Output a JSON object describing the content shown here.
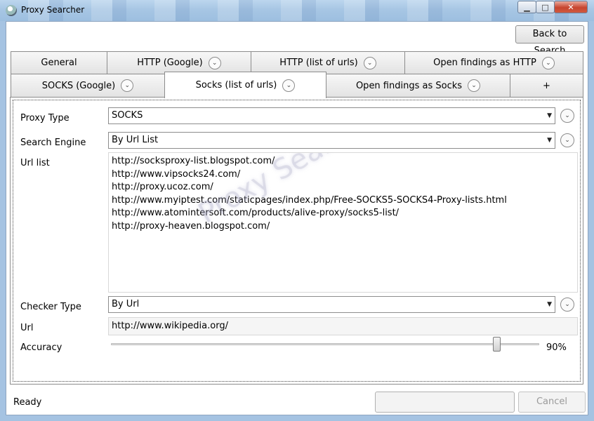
{
  "window": {
    "title": "Proxy Searcher",
    "minimize_glyph": "▁",
    "maximize_glyph": "□",
    "close_glyph": "✕"
  },
  "toolbar": {
    "back_label": "Back to Search"
  },
  "tabs": {
    "row1": [
      {
        "label": "General"
      },
      {
        "label": "HTTP (Google)"
      },
      {
        "label": "HTTP (list of urls)"
      },
      {
        "label": "Open findings as HTTP"
      }
    ],
    "row2": [
      {
        "label": "SOCKS (Google)"
      },
      {
        "label": "Socks (list of urls)"
      },
      {
        "label": "Open findings as Socks"
      },
      {
        "label": "+"
      }
    ],
    "active": "Socks (list of urls)"
  },
  "form": {
    "proxy_type": {
      "label": "Proxy Type",
      "value": "SOCKS"
    },
    "search_engine": {
      "label": "Search Engine",
      "value": "By Url List"
    },
    "url_list": {
      "label": "Url list",
      "items": [
        "http://socksproxy-list.blogspot.com/",
        "http://www.vipsocks24.com/",
        "http://proxy.ucoz.com/",
        "http://www.myiptest.com/staticpages/index.php/Free-SOCKS5-SOCKS4-Proxy-lists.html",
        "http://www.atomintersoft.com/products/alive-proxy/socks5-list/",
        "http://proxy-heaven.blogspot.com/"
      ],
      "watermark": "Proxy Searcher"
    },
    "checker_type": {
      "label": "Checker Type",
      "value": "By Url"
    },
    "url": {
      "label": "Url",
      "value": "http://www.wikipedia.org/"
    },
    "accuracy": {
      "label": "Accuracy",
      "value_text": "90%",
      "value": 0.9
    }
  },
  "statusbar": {
    "status": "Ready",
    "cancel_label": "Cancel"
  },
  "icons": {
    "combo_arrow": "▼",
    "expand_chevron": "⌄"
  }
}
